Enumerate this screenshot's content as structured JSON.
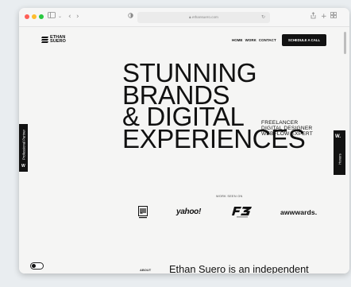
{
  "browser": {
    "url": "ethansuero.com",
    "icons": [
      "sidebar-icon",
      "back-icon",
      "forward-icon",
      "privacy-icon",
      "reload-icon",
      "share-icon",
      "new-tab-icon",
      "tabs-overview-icon"
    ],
    "traffic_light_colors": [
      "#ff5f57",
      "#febc2e",
      "#28c840"
    ]
  },
  "site": {
    "logo_line1": "ETHAN",
    "logo_line2": "SUERO",
    "nav": {
      "home": "HOME",
      "work": "WORK",
      "contact": "CONTACT"
    },
    "cta": "SCHEDULE A CALL",
    "hero": [
      "STUNNING",
      "BRANDS",
      "& DIGITAL",
      "EXPERIENCES"
    ],
    "subtitle": [
      "FREELANCER",
      "DIGITAL DESIGNER",
      "WEBFLOW EXPERT"
    ],
    "left_tab": {
      "label": "Professional Partner",
      "mark": "W"
    },
    "right_tab": {
      "mark": "W.",
      "label": "Honors"
    },
    "work_seen_on": "WORK SEEN ON",
    "brands": [
      "yahoo!",
      "awwwards."
    ],
    "about_label": "ABOUT",
    "intro": "Ethan Suero is an independent"
  }
}
